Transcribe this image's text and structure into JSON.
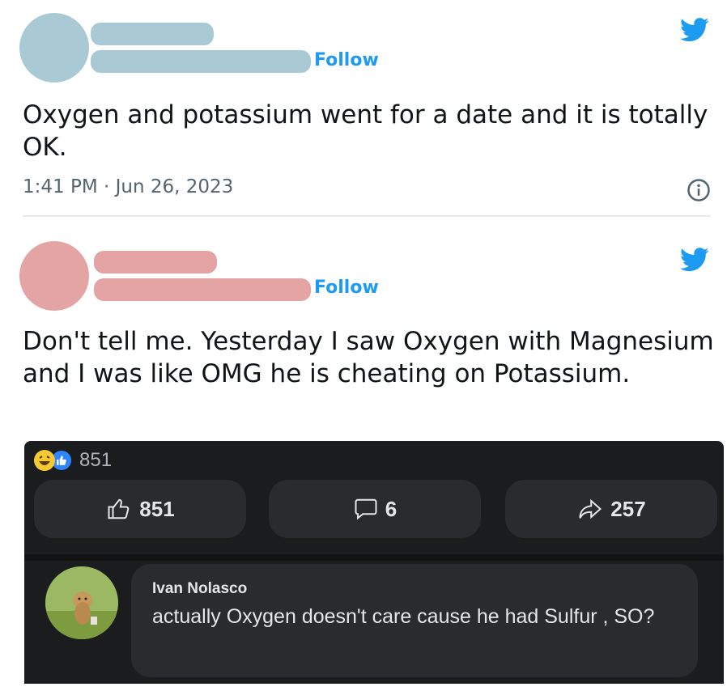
{
  "tweets": [
    {
      "follow_label": "Follow",
      "text": "Oxygen and potassium went for a date and it is totally OK.",
      "timestamp": "1:41 PM · Jun 26, 2023",
      "avatar_color": "#a9cad4",
      "bar_color": "#a9cad4"
    },
    {
      "follow_label": "Follow",
      "text": "Don't tell me. Yesterday I saw Oxygen with Magnesium and I was like OMG he is cheating on Potassium.",
      "avatar_color": "#e4a4a4",
      "bar_color": "#e4a4a4"
    }
  ],
  "icons": {
    "brand": "twitter-bird-icon",
    "info": "info-icon",
    "like": "thumbs-up-icon",
    "comment": "comment-icon",
    "share": "share-icon"
  },
  "colors": {
    "accent": "#1d9bf0",
    "secondary_text": "#536471"
  },
  "embedded_post": {
    "reaction_count": "851",
    "like_count": "851",
    "comment_count": "6",
    "share_count": "257",
    "comment": {
      "author": "Ivan Nolasco",
      "text": "actually Oxygen doesn't care cause he had Sulfur , SO?"
    }
  }
}
